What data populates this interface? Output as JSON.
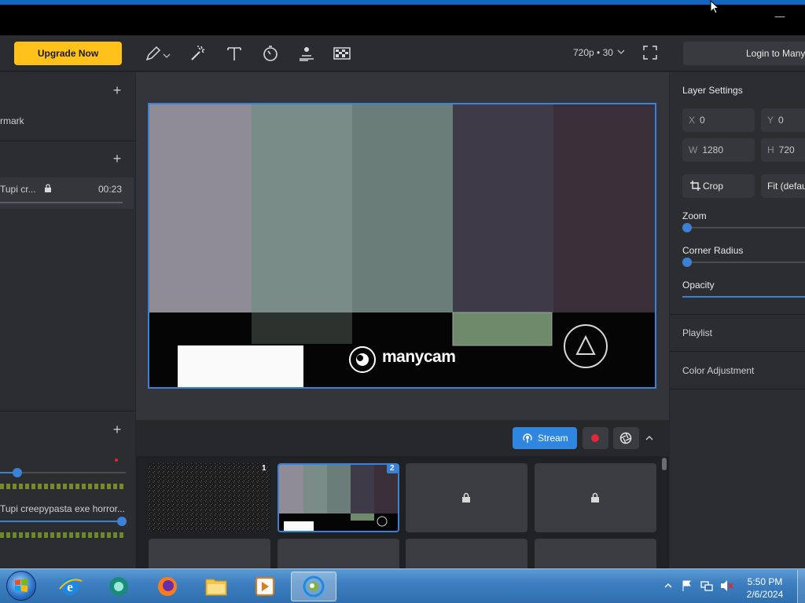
{
  "toolbar": {
    "upgrade_label": "Upgrade Now",
    "resolution": "720p • 30",
    "login_label": "Login to Many"
  },
  "left_panel": {
    "section1_item": "rmark",
    "section2_item_name": "Tupi cr...",
    "section2_item_duration": "00:23",
    "section3_item_name": "Tupi creepypasta exe horror..."
  },
  "preview": {
    "watermark_text": "manycam"
  },
  "stream_bar": {
    "stream_label": "Stream"
  },
  "scenes": [
    {
      "number": "1"
    },
    {
      "number": "2"
    }
  ],
  "right_panel": {
    "layer_settings_title": "Layer Settings",
    "x_label": "X",
    "x_value": "0",
    "y_label": "Y",
    "y_value": "0",
    "w_label": "W",
    "w_value": "1280",
    "h_label": "H",
    "h_value": "720",
    "crop_label": "Crop",
    "fit_label": "Fit (defau",
    "zoom_label": "Zoom",
    "corner_radius_label": "Corner Radius",
    "opacity_label": "Opacity",
    "playlist_label": "Playlist",
    "color_adjustment_label": "Color Adjustment"
  },
  "taskbar": {
    "time": "5:50 PM",
    "date": "2/6/2024"
  },
  "colors": {
    "accent": "#3b82d6",
    "upgrade": "#ffc21a",
    "stream": "#2f86e0",
    "record": "#e0283a"
  }
}
